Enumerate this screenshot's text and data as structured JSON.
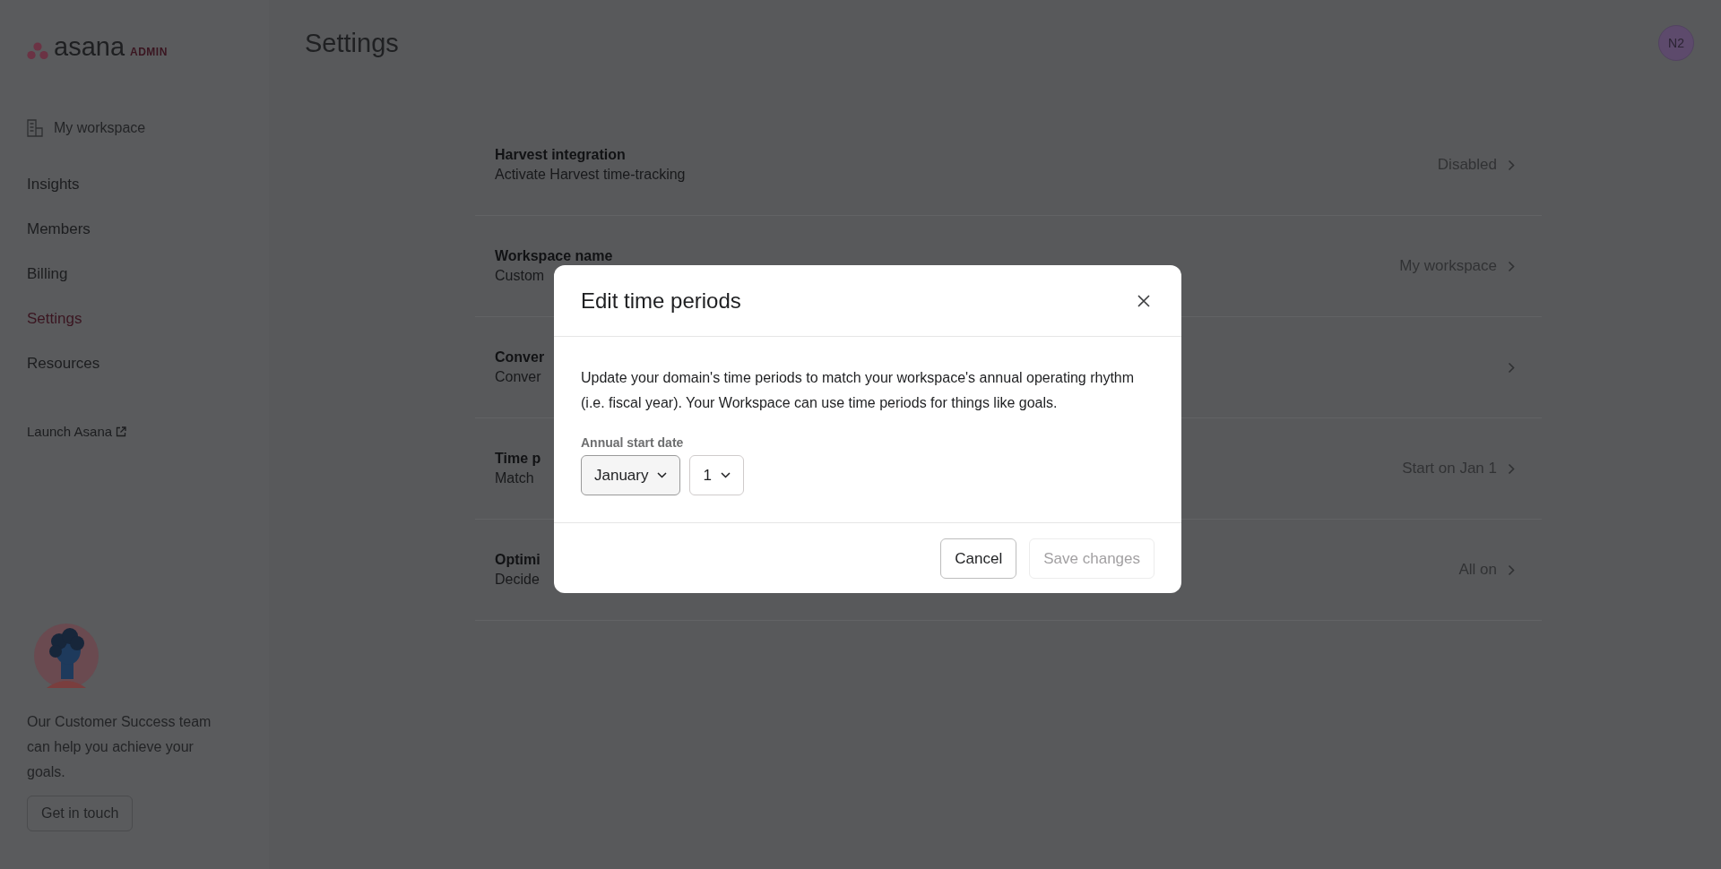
{
  "sidebar": {
    "logo": {
      "wordmark": "asana",
      "badge": "ADMIN"
    },
    "workspace": "My workspace",
    "items": [
      {
        "label": "Insights",
        "selected": false
      },
      {
        "label": "Members",
        "selected": false
      },
      {
        "label": "Billing",
        "selected": false
      },
      {
        "label": "Settings",
        "selected": true
      },
      {
        "label": "Resources",
        "selected": false
      }
    ],
    "launch_link": "Launch Asana",
    "help": {
      "text": "Our Customer Success team can help you achieve your goals.",
      "button": "Get in touch"
    }
  },
  "header": {
    "title": "Settings",
    "avatar": "N2"
  },
  "settings_rows": [
    {
      "title": "Harvest integration",
      "subtitle": "Activate Harvest time-tracking",
      "value": "Disabled"
    },
    {
      "title": "Workspace name",
      "subtitle": "Custom",
      "value": "My workspace"
    },
    {
      "title": "Conver",
      "subtitle": "Conver"
    },
    {
      "title": "Time p",
      "subtitle": "Match",
      "value": "Start on Jan 1"
    },
    {
      "title": "Optimi",
      "subtitle": "Decide",
      "value": "All on"
    }
  ],
  "dialog": {
    "title": "Edit time periods",
    "description": "Update your domain's time periods to match your workspace's annual operating rhythm (i.e. fiscal year). Your Workspace can use time periods for things like goals.",
    "field_label": "Annual start date",
    "selects": [
      {
        "value": "January",
        "focused": true
      },
      {
        "value": "1",
        "focused": false
      }
    ],
    "buttons": [
      {
        "label": "Cancel",
        "disabled": false
      },
      {
        "label": "Save changes",
        "disabled": true
      }
    ]
  }
}
